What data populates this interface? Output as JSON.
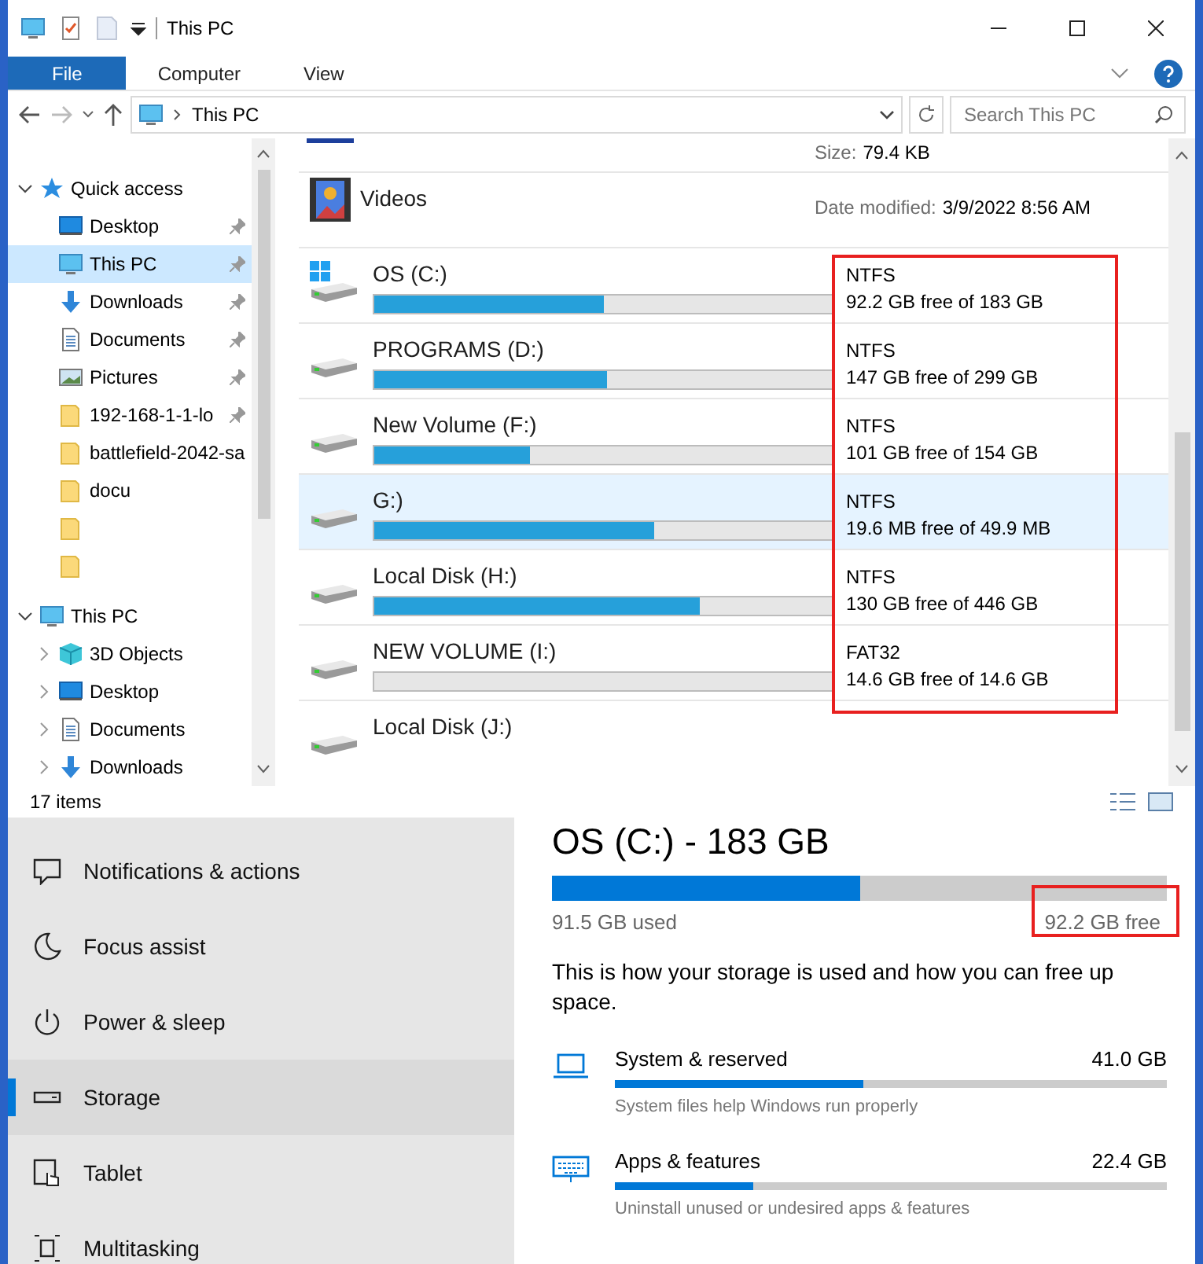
{
  "window": {
    "title": "This PC"
  },
  "ribbon_tabs": [
    {
      "label": "File",
      "selected": true
    },
    {
      "label": "Computer",
      "selected": false
    },
    {
      "label": "View",
      "selected": false
    }
  ],
  "address": {
    "path": "This PC"
  },
  "search": {
    "placeholder": "Search This PC"
  },
  "nav": [
    {
      "label": "Quick access",
      "kind": "star",
      "expanded": true,
      "selected": false,
      "children": [
        {
          "label": "Desktop",
          "kind": "desktop",
          "pinned": true,
          "selected": false
        },
        {
          "label": "This PC",
          "kind": "pc",
          "pinned": true,
          "selected": true
        },
        {
          "label": "Downloads",
          "kind": "download",
          "pinned": true,
          "selected": false
        },
        {
          "label": "Documents",
          "kind": "document",
          "pinned": true,
          "selected": false
        },
        {
          "label": "Pictures",
          "kind": "picture",
          "pinned": true,
          "selected": false
        },
        {
          "label": "192-168-1-1-lo",
          "kind": "folder",
          "pinned": true,
          "selected": false
        },
        {
          "label": "battlefield-2042-sa",
          "kind": "folder",
          "pinned": false,
          "selected": false
        },
        {
          "label": "docu",
          "kind": "folder",
          "pinned": false,
          "selected": false
        },
        {
          "kind": "folder"
        },
        {
          "kind": "folder"
        }
      ]
    },
    {
      "label": "This PC",
      "kind": "pc",
      "expanded": true,
      "selected": false,
      "children": [
        {
          "label": "3D Objects",
          "kind": "cube",
          "expanded": false,
          "selected": false
        },
        {
          "label": "Desktop",
          "kind": "desktop",
          "expanded": false,
          "selected": false
        },
        {
          "label": "Documents",
          "kind": "document",
          "expanded": false,
          "selected": false
        },
        {
          "label": "Downloads",
          "kind": "download",
          "expanded": false,
          "selected": false
        }
      ]
    }
  ],
  "content": {
    "size_label": "Size:",
    "size_value": "79.4 KB",
    "folder": {
      "name": "Videos",
      "date_label": "Date modified:",
      "date_value": "3/9/2022 8:56 AM"
    },
    "drives": [
      {
        "name": "OS (C:)",
        "kind": "system",
        "level": 0.5,
        "filesystem": "NTFS",
        "free": "92.2 GB free of 183 GB",
        "selected": false
      },
      {
        "name": "PROGRAMS (D:)",
        "kind": "disk",
        "level": 0.51,
        "filesystem": "NTFS",
        "free": "147 GB free of 299 GB",
        "selected": false
      },
      {
        "name": "New Volume (F:)",
        "kind": "disk",
        "level": 0.34,
        "filesystem": "NTFS",
        "free": "101 GB free of 154 GB",
        "selected": false
      },
      {
        "name": "G:)",
        "kind": "disk",
        "level": 0.61,
        "filesystem": "NTFS",
        "free": "19.6 MB free of 49.9 MB",
        "selected": true
      },
      {
        "name": "Local Disk (H:)",
        "kind": "disk",
        "level": 0.71,
        "filesystem": "NTFS",
        "free": "130 GB free of 446 GB",
        "selected": false
      },
      {
        "name": "NEW VOLUME (I:)",
        "kind": "disk",
        "level": 0,
        "filesystem": "FAT32",
        "free": "14.6 GB free of 14.6 GB",
        "selected": false
      },
      {
        "name": "Local Disk (J:)",
        "kind": "disk",
        "selected": false
      }
    ]
  },
  "status_bar": {
    "items": "17 items"
  },
  "settings": {
    "nav": [
      {
        "label": "Notifications & actions",
        "kind": "notify",
        "selected": false
      },
      {
        "label": "Focus assist",
        "kind": "moon",
        "selected": false
      },
      {
        "label": "Power & sleep",
        "kind": "power",
        "selected": false
      },
      {
        "label": "Storage",
        "kind": "storage",
        "selected": true
      },
      {
        "label": "Tablet",
        "kind": "tablet",
        "selected": false
      },
      {
        "label": "Multitasking",
        "kind": "multitask",
        "selected": false
      }
    ],
    "drive_title": "OS (C:) - 183 GB",
    "level": 0.5,
    "used": "91.5 GB used",
    "free": "92.2 GB free",
    "description": "This is how your storage is used and how you can free up space.",
    "categories": [
      {
        "name": "System & reserved",
        "kind": "laptop",
        "size": "41.0 GB",
        "level": 0.45,
        "note": "System files help Windows run properly"
      },
      {
        "name": "Apps & features",
        "kind": "keyboard",
        "size": "22.4 GB",
        "level": 0.25,
        "note": "Uninstall unused or undesired apps & features"
      }
    ]
  }
}
